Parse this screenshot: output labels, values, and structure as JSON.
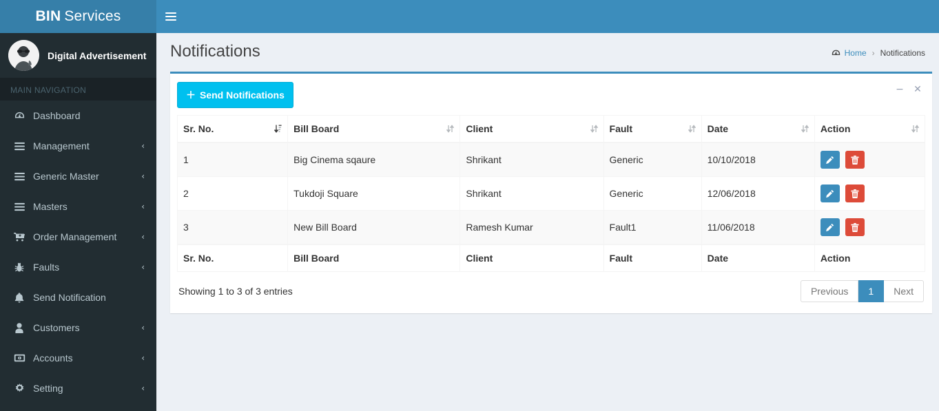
{
  "brand": {
    "bold": "BIN",
    "light": "Services"
  },
  "user_panel": {
    "name": "Digital Advertisement",
    "avatar_alt": "user-avatar"
  },
  "sidebar": {
    "header": "MAIN NAVIGATION",
    "items": [
      {
        "label": "Dashboard",
        "icon": "dashboard-icon",
        "caret": ""
      },
      {
        "label": "Management",
        "icon": "bars-icon",
        "caret": "‹"
      },
      {
        "label": "Generic Master",
        "icon": "bars-icon",
        "caret": "‹"
      },
      {
        "label": "Masters",
        "icon": "bars-icon",
        "caret": "‹"
      },
      {
        "label": "Order Management",
        "icon": "shopping-cart-icon",
        "caret": "‹"
      },
      {
        "label": "Faults",
        "icon": "bug-icon",
        "caret": "‹"
      },
      {
        "label": "Send Notification",
        "icon": "bell-icon",
        "caret": ""
      },
      {
        "label": "Customers",
        "icon": "user-icon",
        "caret": "‹"
      },
      {
        "label": "Accounts",
        "icon": "money-icon",
        "caret": "‹"
      },
      {
        "label": "Setting",
        "icon": "gear-icon",
        "caret": "‹"
      }
    ]
  },
  "navbar": {
    "toggle_icon": "hamburger-icon"
  },
  "header": {
    "title": "Notifications",
    "breadcrumb": {
      "home": "Home",
      "separator": "›",
      "current": "Notifications",
      "home_icon": "dashboard-icon"
    }
  },
  "box": {
    "send_button": "Send Notifications",
    "send_button_plus": "＋",
    "minimize": "−",
    "close": "✕"
  },
  "table": {
    "columns": [
      "Sr. No.",
      "Bill Board",
      "Client",
      "Fault",
      "Date",
      "Action"
    ],
    "sorted_column": "Sr. No.",
    "sort_direction": "asc",
    "rows": [
      {
        "sr": "1",
        "billboard": "Big Cinema sqaure",
        "client": "Shrikant",
        "fault": "Generic",
        "date": "10/10/2018"
      },
      {
        "sr": "2",
        "billboard": "Tukdoji Square",
        "client": "Shrikant",
        "fault": "Generic",
        "date": "12/06/2018"
      },
      {
        "sr": "3",
        "billboard": "New Bill Board",
        "client": "Ramesh Kumar",
        "fault": "Fault1",
        "date": "11/06/2018"
      }
    ],
    "row_actions": {
      "edit": "edit-icon",
      "delete": "trash-icon"
    }
  },
  "footer": {
    "info": "Showing 1 to 3 of 3 entries",
    "pagination": {
      "previous": "Previous",
      "pages": [
        "1"
      ],
      "next": "Next",
      "active": "1"
    }
  },
  "colors": {
    "navbar": "#3c8dbc",
    "logo": "#367fa9",
    "sidebar": "#222d32",
    "sidebar_header": "#1a2226",
    "content_bg": "#ecf0f5",
    "info_button": "#00c0ef",
    "edit_button": "#3c8dbc",
    "delete_button": "#dd4b39"
  }
}
